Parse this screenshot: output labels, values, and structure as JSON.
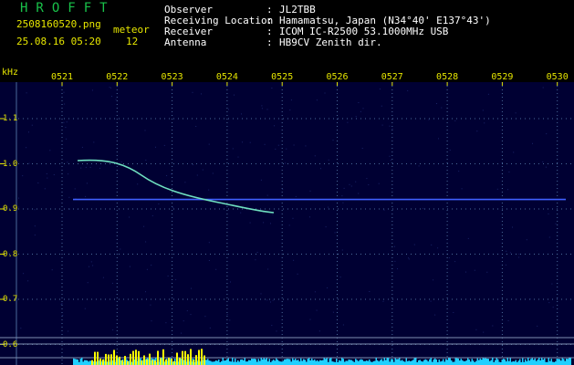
{
  "header": {
    "app_name": "HROFFT",
    "file_name": "2508160520.png",
    "date_time": "25.08.16 05:20",
    "mode_label": "meteor",
    "mode_count": "12"
  },
  "station": [
    {
      "label": "Observer",
      "value": "JL2TBB"
    },
    {
      "label": "Receiving Location",
      "value": "Hamamatsu, Japan (N34°40' E137°43')"
    },
    {
      "label": "Receiver",
      "value": "ICOM IC-R2500 53.1000MHz USB"
    },
    {
      "label": "Antenna",
      "value": "HB9CV Zenith dir."
    }
  ],
  "separator": ":",
  "chart_data": {
    "type": "heatmap",
    "ylabel": "kHz",
    "y_ticks": [
      "1.1",
      "1.0",
      "0.9",
      "0.8",
      "0.7",
      "0.6"
    ],
    "x_ticks": [
      "0521",
      "0522",
      "0523",
      "0524",
      "0525",
      "0526",
      "0527",
      "0528",
      "0529",
      "0530"
    ],
    "ylim": [
      0.58,
      1.18
    ],
    "xlim": [
      "0520.7",
      "0530.1"
    ],
    "carrier_khz": 0.921,
    "colors": {
      "background": "#000033",
      "grid": "#4a6a9a",
      "carrier": "#4060ff",
      "meteor_trace": "#6fe0c0",
      "noise": "#20d0ff",
      "activity": "#ffff00",
      "text": "#e6e600"
    }
  }
}
